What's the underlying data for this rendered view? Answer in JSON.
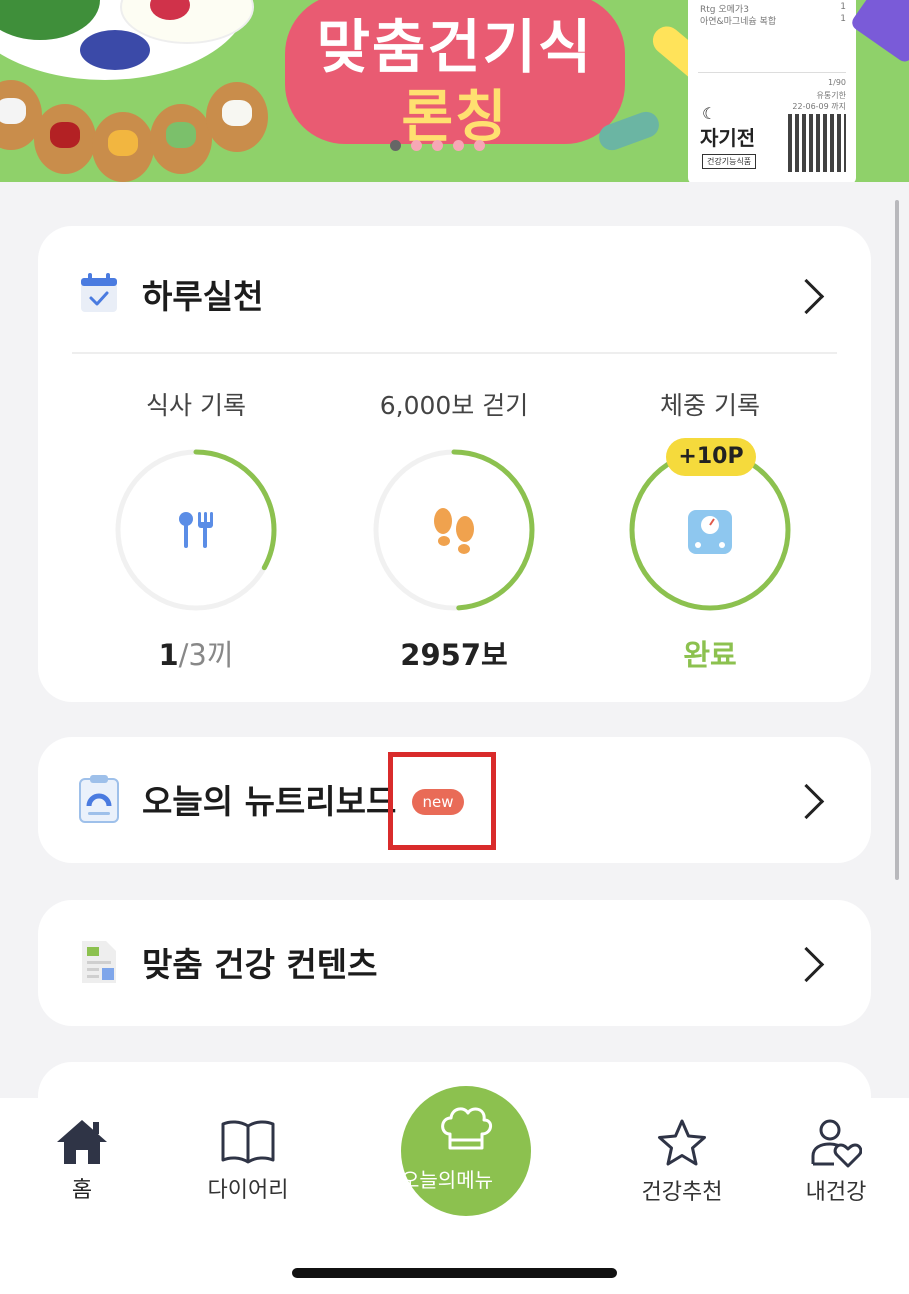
{
  "banner": {
    "title_line1": "맞춤건기식",
    "title_line2": "론칭",
    "label_brand": "자기전",
    "label_tag": "건강기능식품",
    "label_line1": "Rtg 오메가3",
    "label_line2": "아연&마그네슘 복합",
    "label_qty1": "1",
    "label_qty2": "1",
    "label_volume": "1/90",
    "label_expiry": "유통기한",
    "label_expiry_date": "22-06-09 까지",
    "slides_total": 5,
    "active_slide": 1
  },
  "daily": {
    "title": "하루실천",
    "meal": {
      "label": "식사 기록",
      "current": "1",
      "unit": "/3끼",
      "progress": 0.33
    },
    "steps": {
      "label": "6,000보 걷기",
      "value": "2957보",
      "progress": 0.49
    },
    "weight": {
      "label": "체중 기록",
      "value": "완료",
      "badge": "+10P",
      "progress": 1.0
    }
  },
  "nutri": {
    "title": "오늘의 뉴트리보드",
    "badge": "new"
  },
  "content": {
    "title": "맞춤 건강 컨텐츠"
  },
  "nav": {
    "home": "홈",
    "diary": "다이어리",
    "menu": "오늘의메뉴",
    "recommend": "건강추천",
    "myhealth": "내건강"
  },
  "colors": {
    "accent": "#8cc14f",
    "badge_yellow": "#f5da3c",
    "new_badge": "#e96b57",
    "highlight": "#d92b2b"
  }
}
